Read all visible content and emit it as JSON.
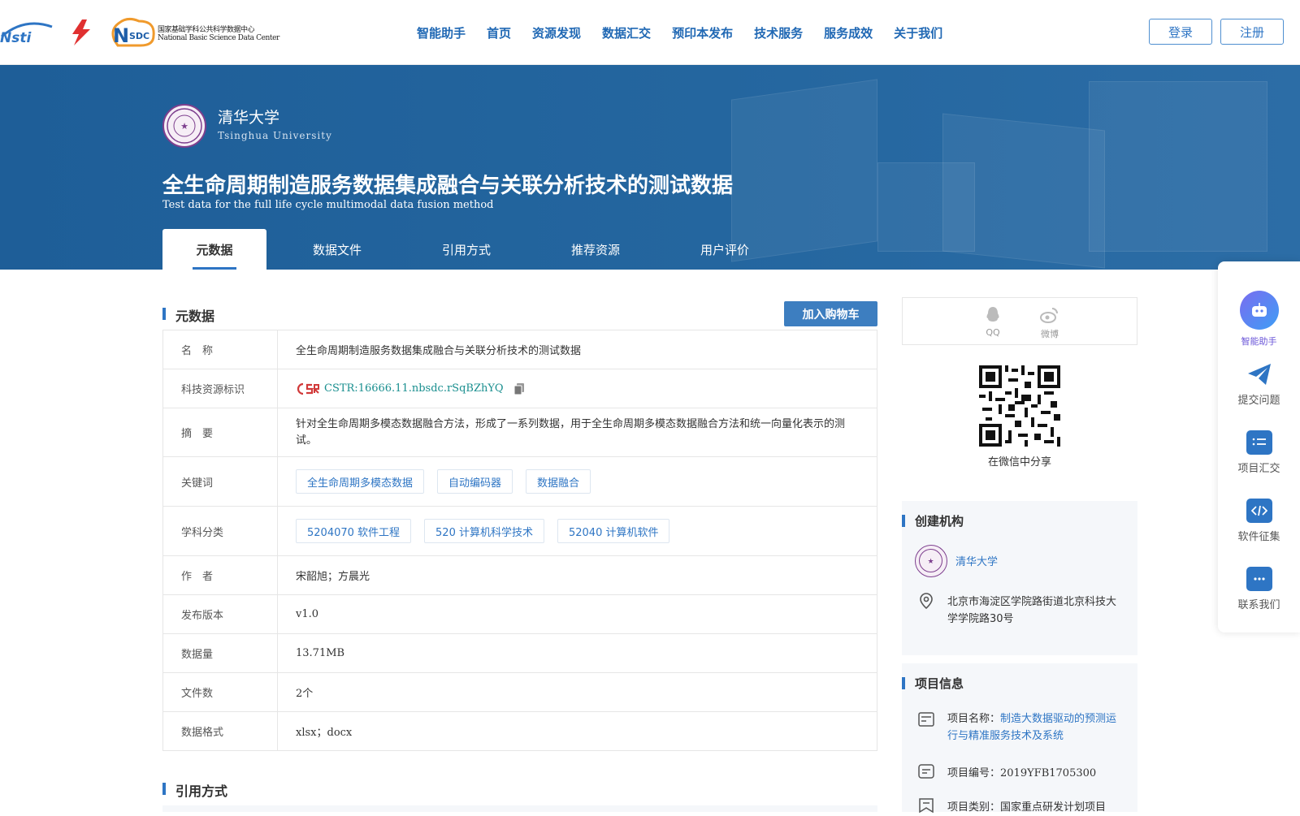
{
  "header": {
    "logo_nstl": "Nsti",
    "logo_nsdc_mark": "NSDC",
    "logo_nsdc_cn": "国家基础学科公共科学数据中心",
    "logo_nsdc_en": "National Basic Science Data Center",
    "nav": [
      "智能助手",
      "首页",
      "资源发现",
      "数据汇交",
      "预印本发布",
      "技术服务",
      "服务成效",
      "关于我们"
    ],
    "login": "登录",
    "register": "注册"
  },
  "hero": {
    "institution_cn": "清华大学",
    "institution_en": "Tsinghua University",
    "title_cn": "全生命周期制造服务数据集成融合与关联分析技术的测试数据",
    "title_en": "Test data for the full life cycle multimodal data fusion method",
    "tabs": [
      "元数据",
      "数据文件",
      "引用方式",
      "推荐资源",
      "用户评价"
    ],
    "active_tab": "元数据"
  },
  "metadata": {
    "section_title": "元数据",
    "cart_button": "加入购物车",
    "rows": {
      "name_label": "名　称",
      "name_value": "全生命周期制造服务数据集成融合与关联分析技术的测试数据",
      "cstr_label": "科技资源标识",
      "cstr_badge": "CSR",
      "cstr_value": "CSTR:16666.11.nbsdc.rSqBZhYQ",
      "abstract_label": "摘　要",
      "abstract_value": "针对全生命周期多模态数据融合方法，形成了一系列数据，用于全生命周期多模态数据融合方法和统一向量化表示的测试。",
      "keywords_label": "关键词",
      "keywords": [
        "全生命周期多模态数据",
        "自动编码器",
        "数据融合"
      ],
      "subject_label": "学科分类",
      "subjects": [
        "5204070 软件工程",
        "520 计算机科学技术",
        "52040 计算机软件"
      ],
      "author_label": "作　者",
      "author_value": "宋韶旭；方晨光",
      "version_label": "发布版本",
      "version_value": "v1.0",
      "size_label": "数据量",
      "size_value": "13.71MB",
      "files_label": "文件数",
      "files_value": "2个",
      "format_label": "数据格式",
      "format_value": "xlsx；docx"
    }
  },
  "citation": {
    "section_title": "引用方式"
  },
  "share": {
    "qq": "QQ",
    "weibo": "微博",
    "wechat": "在微信中分享"
  },
  "creator": {
    "title": "创建机构",
    "name": "清华大学",
    "address": "北京市海淀区学院路街道北京科技大学学院路30号"
  },
  "project": {
    "title": "项目信息",
    "name_label": "项目名称：",
    "name_value": "制造大数据驱动的预测运行与精准服务技术及系统",
    "code_label": "项目编号：",
    "code_value": "2019YFB1705300",
    "type_label": "项目类别：",
    "type_value": "国家重点研发计划项目"
  },
  "float_menu": [
    "智能助手",
    "提交问题",
    "项目汇交",
    "软件征集",
    "联系我们"
  ],
  "colors": {
    "primary": "#2e75c4",
    "hero": "#236199",
    "accent_purple": "#7d3f8e"
  }
}
